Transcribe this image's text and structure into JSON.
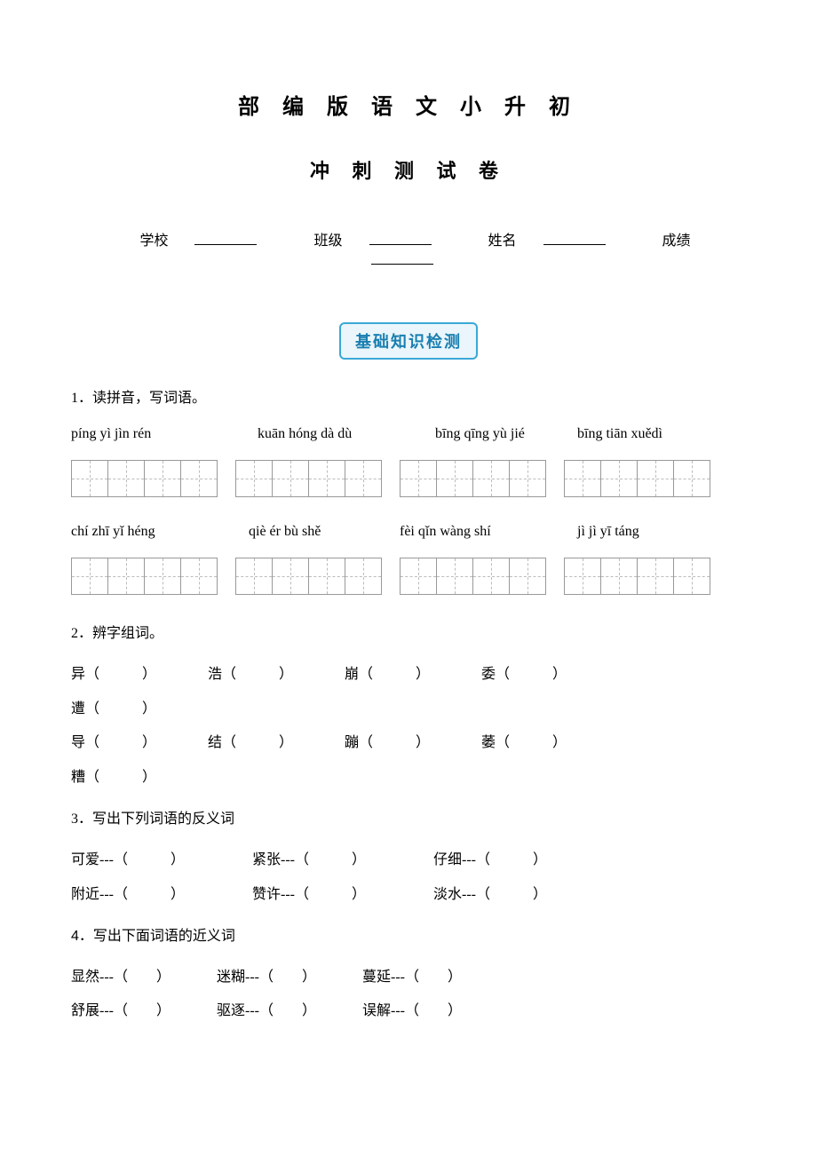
{
  "title_main": "部 编 版 语 文 小 升 初",
  "title_sub": "冲 刺 测 试 卷",
  "info": {
    "school_label": "学校",
    "class_label": "班级",
    "name_label": "姓名",
    "score_label": "成绩"
  },
  "section_badge": "基础知识检测",
  "q1": {
    "prompt": "1．读拼音，写词语。",
    "row1": [
      "píng yì jìn rén",
      "kuān hóng dà dù",
      "bīng qīng yù jié",
      "bīng tiān xuědì"
    ],
    "row2": [
      "chí zhī yǐ héng",
      "qiè ér bù shě",
      "fèi qǐn wàng shí",
      "jì jì yī táng"
    ]
  },
  "q2": {
    "prompt": "2．辨字组词。",
    "row1": [
      "异（　　　）",
      "浩（　　　）",
      "崩（　　　）",
      "委（　　　）",
      "遭（　　　）"
    ],
    "row2": [
      "导（　　　）",
      "结（　　　）",
      "蹦（　　　）",
      "萎（　　　）",
      "糟（　　　）"
    ]
  },
  "q3": {
    "prompt": "3．写出下列词语的反义词",
    "row1": [
      "可爱---（　　　）",
      "紧张---（　　　）",
      "仔细---（　　　）"
    ],
    "row2": [
      "附近---（　　　）",
      "赞许---（　　　）",
      "淡水---（　　　）"
    ]
  },
  "q4": {
    "num": "4",
    "prompt_rest": "．写出下面词语的近义词",
    "row1": [
      "显然---（　　）",
      "迷糊---（　　）",
      "蔓延---（　　）"
    ],
    "row2": [
      "舒展---（　　）",
      "驱逐---（　　）",
      "误解---（　　）"
    ]
  }
}
